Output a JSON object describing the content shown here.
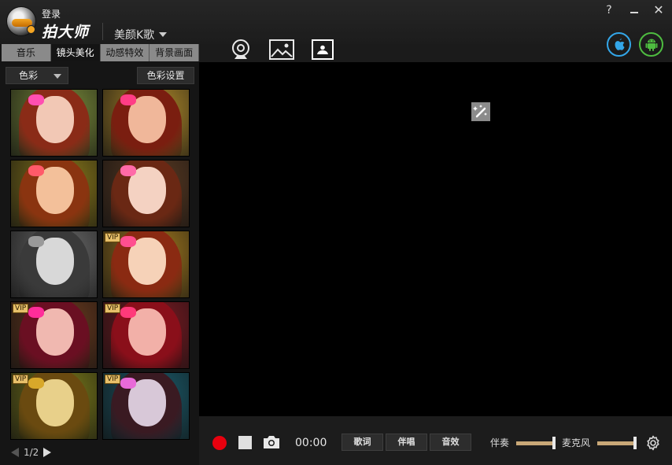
{
  "header": {
    "login": "登录",
    "brand": "拍大师",
    "karaoke": "美颜K歌",
    "help": "?",
    "close": "✕"
  },
  "tabs": [
    "音乐",
    "镜头美化",
    "动感特效",
    "背景画面"
  ],
  "active_tab": 1,
  "filter": {
    "select_value": "色彩",
    "settings_button": "色彩设置"
  },
  "thumbnails": [
    {
      "vip": false,
      "bg": "#7a8c3a",
      "hair": "#8a2b17",
      "skin": "#f2c8b5",
      "bow": "#ff4fb1"
    },
    {
      "vip": false,
      "bg": "#b08a2a",
      "hair": "#7a1e10",
      "skin": "#f0b79a",
      "bow": "#ff3d86"
    },
    {
      "vip": false,
      "bg": "#8b7a1a",
      "hair": "#8a3410",
      "skin": "#f3c09a",
      "bow": "#ff5a6a"
    },
    {
      "vip": false,
      "bg": "#5a3a22",
      "hair": "#6a2814",
      "skin": "#f4d2c2",
      "bow": "#ff6aa8"
    },
    {
      "vip": false,
      "bg": "#6a6a6a",
      "hair": "#3a3a3a",
      "skin": "#d8d8d8",
      "bow": "#9a9a9a"
    },
    {
      "vip": true,
      "vip_label": "VIP",
      "bg": "#a0781e",
      "hair": "#8a2a12",
      "skin": "#f6d2b8",
      "bow": "#ff4f8f"
    },
    {
      "vip": true,
      "vip_label": "VIP",
      "bg": "#6a3a1e",
      "hair": "#6a0f22",
      "skin": "#f0b8b0",
      "bow": "#ff2d9a"
    },
    {
      "vip": true,
      "vip_label": "VIP",
      "bg": "#7a1a22",
      "hair": "#8a0f1a",
      "skin": "#f2b0a8",
      "bow": "#ff3a7a"
    },
    {
      "vip": true,
      "vip_label": "VIP",
      "bg": "#7a7a1a",
      "hair": "#6a4a10",
      "skin": "#e8d08a",
      "bow": "#d8a82a"
    },
    {
      "vip": true,
      "vip_label": "VIP",
      "bg": "#1a5a6a",
      "hair": "#3a1a22",
      "skin": "#d8c8d8",
      "bow": "#e86ad8"
    }
  ],
  "pager": {
    "label": "1/2"
  },
  "bottom": {
    "timer": "00:00",
    "lyrics": "歌词",
    "chorus": "伴唱",
    "effects": "音效",
    "accompaniment": "伴奏",
    "accompaniment_level": 1.0,
    "microphone": "麦克风",
    "microphone_level": 1.0
  },
  "colors": {
    "record": "#e8000e",
    "slider": "#c9a877",
    "ios": "#33a6e8",
    "android": "#4ebc40"
  }
}
